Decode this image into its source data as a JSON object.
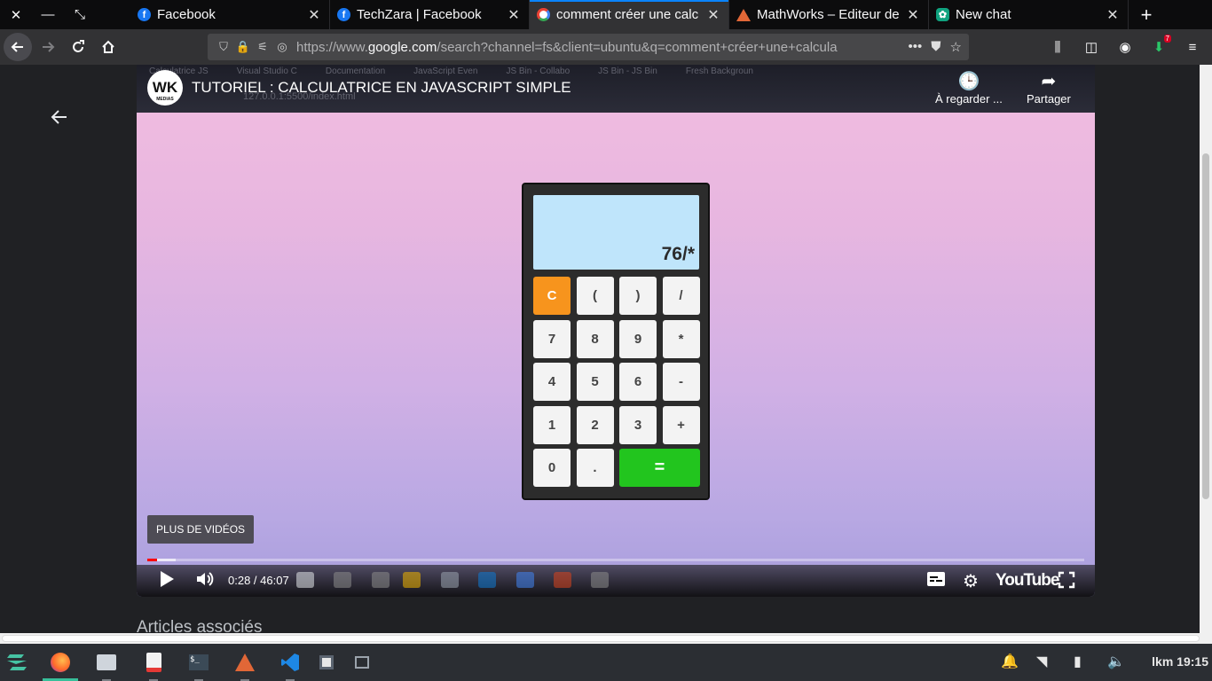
{
  "window": {
    "close": "✕",
    "minimize": "—",
    "restore": "⤡"
  },
  "tabs": [
    {
      "title": "Facebook",
      "favicon": "facebook-icon",
      "active": false
    },
    {
      "title": "TechZara | Facebook",
      "favicon": "facebook-icon",
      "active": false
    },
    {
      "title": "comment créer une calc",
      "favicon": "google-icon",
      "active": true
    },
    {
      "title": "MathWorks – Editeur de",
      "favicon": "matlab-icon",
      "active": false
    },
    {
      "title": "New chat",
      "favicon": "chatgpt-icon",
      "active": false
    }
  ],
  "url": {
    "prefix": "https://www.",
    "domain": "google.com",
    "path": "/search?channel=fs&client=ubuntu&q=comment+créer+une+calcula"
  },
  "downloads_badge": "7",
  "video": {
    "title": "TUTORIEL : CALCULATRICE EN JAVASCRIPT SIMPLE",
    "channel_logo": "WK",
    "channel_sub": "MEDIAS",
    "watch_later": "À regarder ...",
    "share": "Partager",
    "ghost_tabs": [
      "Calculatrice JS",
      "Visual Studio C",
      "Documentation",
      "JavaScript Even",
      "JS Bin - Collabo",
      "JS Bin - JS Bin",
      "Fresh Backgroun"
    ],
    "ghost_url": "127.0.0.1:5500/index.html",
    "more_videos": "PLUS DE VIDÉOS",
    "time": "0:28 / 46:07",
    "progress": {
      "played": 0.01,
      "buffered": 0.03
    },
    "logo": "YouTube",
    "calculator": {
      "display": "76/*",
      "keys": [
        "C",
        "(",
        ")",
        "/",
        "7",
        "8",
        "9",
        "*",
        "4",
        "5",
        "6",
        "-",
        "1",
        "2",
        "3",
        "+",
        "0",
        ".",
        "="
      ]
    }
  },
  "page": {
    "related_heading": "Articles associés"
  },
  "taskbar": {
    "clock": "lkm 19:15"
  },
  "colors": {
    "accent": "#0a84ff",
    "calc_display": "#bfe5fb",
    "clear_key": "#f7941d",
    "equals_key": "#22c51e",
    "progress_red": "#ff0000"
  }
}
